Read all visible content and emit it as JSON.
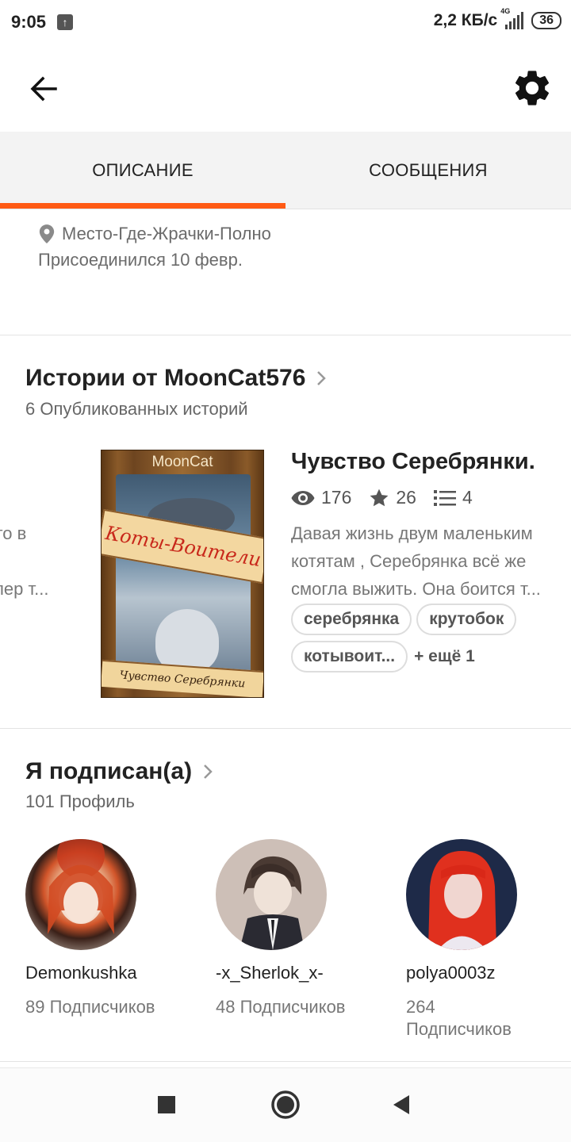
{
  "status_bar": {
    "time": "9:05",
    "net_speed": "2,2 КБ/с",
    "network_type": "4G",
    "battery": "36"
  },
  "app_bar": {
    "back_icon": "arrow-left-icon",
    "settings_icon": "gear-icon"
  },
  "tabs": [
    {
      "label": "ОПИСАНИЕ",
      "active": true
    },
    {
      "label": "СООБЩЕНИЯ",
      "active": false
    }
  ],
  "about": {
    "location": "Место-Где-Жрачки-Полно",
    "joined": "Присоединился 10 февр."
  },
  "stories": {
    "title": "Истории от MoonCat576",
    "subtitle": "6 Опубликованных историй",
    "previous_card_lines": [
      "что в",
      "!",
      "упер т..."
    ],
    "cover_text": {
      "author": "MoonCat",
      "banner": "Коты-Воители",
      "bottom": "Чувство Серебрянки"
    },
    "card": {
      "title": "Чувство Серебрянки.",
      "views": "176",
      "votes": "26",
      "parts": "4",
      "description_lines": [
        "Давая жизнь двум маленьким",
        "котятам , Серебрянка всё же",
        "смогла выжить. Она боится  т..."
      ],
      "tags": [
        "серебрянка",
        "крутобок",
        "котывоит..."
      ],
      "more_tags": "+ ещё 1"
    }
  },
  "following": {
    "title": "Я подписан(а)",
    "subtitle": "101 Профиль",
    "profiles": [
      {
        "name": "Demonkushka",
        "followers": "89 Подписчиков"
      },
      {
        "name": "-x_Sherlok_x-",
        "followers": "48 Подписчиков"
      },
      {
        "name": "polya0003z",
        "followers_line1": "264",
        "followers_line2": "Подписчиков"
      }
    ]
  },
  "nav_bar": {
    "recents_icon": "square-icon",
    "home_icon": "circle-icon",
    "back_icon": "triangle-back-icon"
  }
}
